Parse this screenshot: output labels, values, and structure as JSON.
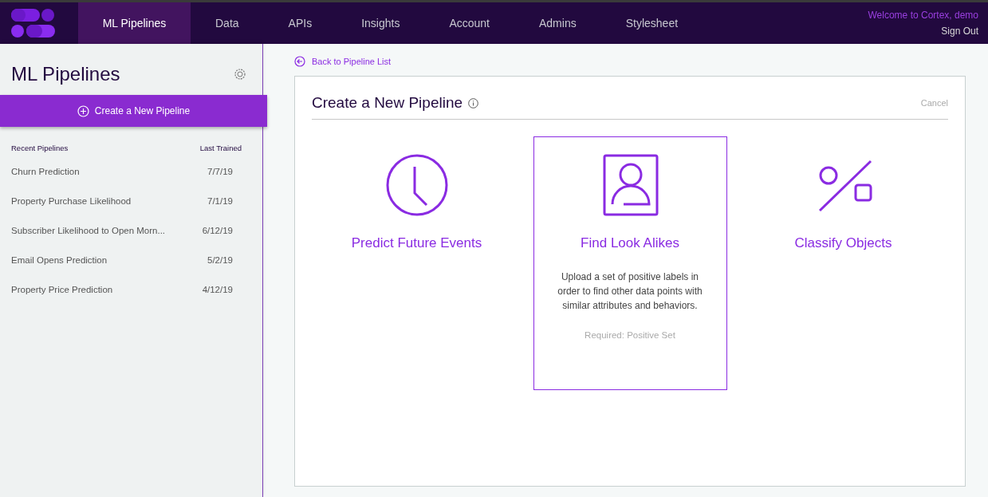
{
  "nav": {
    "tabs": [
      {
        "label": "ML Pipelines",
        "selected": true
      },
      {
        "label": "Data",
        "selected": false
      },
      {
        "label": "APIs",
        "selected": false
      },
      {
        "label": "Insights",
        "selected": false
      },
      {
        "label": "Account",
        "selected": false
      },
      {
        "label": "Admins",
        "selected": false
      },
      {
        "label": "Stylesheet",
        "selected": false
      }
    ],
    "welcome": "Welcome to Cortex, demo",
    "sign_out": "Sign Out"
  },
  "sidebar": {
    "title": "ML Pipelines",
    "create_button": "Create a New Pipeline",
    "columns": [
      "Recent Pipelines",
      "Last Trained"
    ],
    "rows": [
      {
        "name": "Churn Prediction",
        "date": "7/7/19"
      },
      {
        "name": "Property Purchase Likelihood",
        "date": "7/1/19"
      },
      {
        "name": "Subscriber Likelihood to Open Morn...",
        "date": "6/12/19"
      },
      {
        "name": "Email Opens Prediction",
        "date": "5/2/19"
      },
      {
        "name": "Property Price Prediction",
        "date": "4/12/19"
      }
    ]
  },
  "main": {
    "back_link": "Back to Pipeline List",
    "title": "Create a New Pipeline",
    "cancel": "Cancel",
    "options": [
      {
        "kind": "clock",
        "label": "Predict Future Events",
        "selected": false
      },
      {
        "kind": "person",
        "label": "Find Look Alikes",
        "selected": true,
        "description": "Upload a set of positive labels in order to find other data points with similar attributes and behaviors.",
        "requirement": "Required: Positive Set"
      },
      {
        "kind": "shapes",
        "label": "Classify Objects",
        "selected": false
      }
    ]
  }
}
